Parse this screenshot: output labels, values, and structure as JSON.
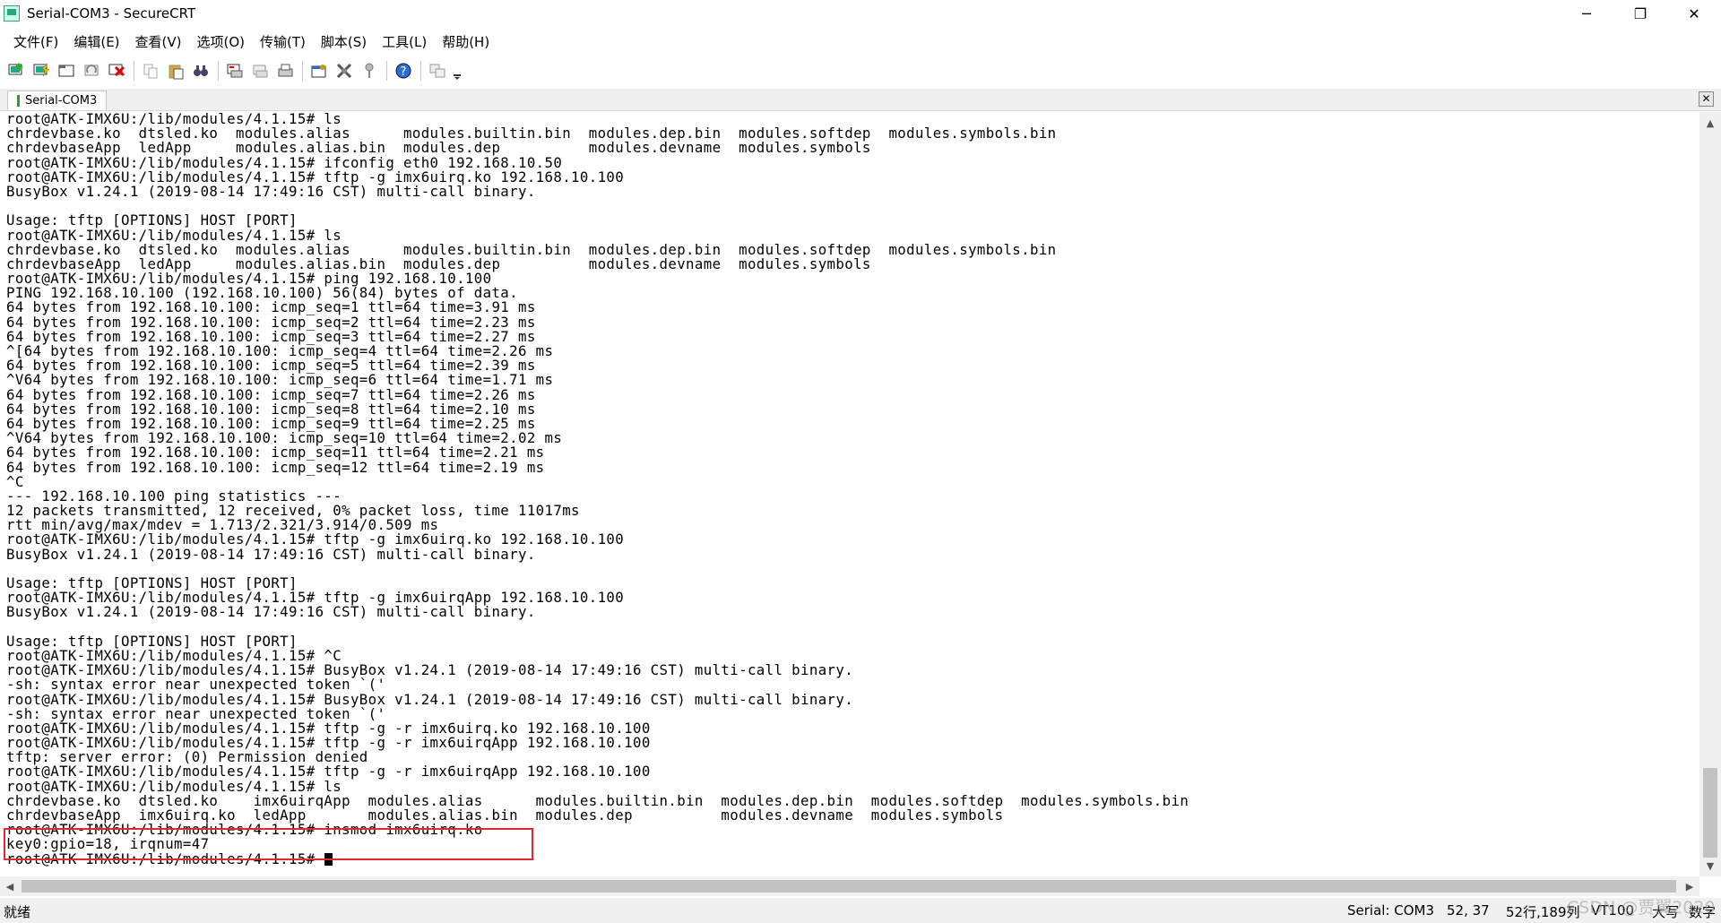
{
  "window": {
    "title": "Serial-COM3 - SecureCRT",
    "controls": [
      "─",
      "❐",
      "✕"
    ]
  },
  "menu": [
    "文件(F)",
    "编辑(E)",
    "查看(V)",
    "选项(O)",
    "传输(T)",
    "脚本(S)",
    "工具(L)",
    "帮助(H)"
  ],
  "toolbar": {
    "icons": [
      "connect-icon",
      "quick-connect-icon",
      "connect-in-tab-icon",
      "reconnect-icon",
      "disconnect-icon",
      "copy-icon",
      "paste-icon",
      "find-icon",
      "print-screen-icon",
      "print-selection-icon",
      "print-icon",
      "session-options-icon",
      "global-options-icon",
      "keymap-icon",
      "help-icon",
      "sftp-icon",
      "toolbar-overflow-icon"
    ]
  },
  "tab": {
    "label": "Serial-COM3",
    "close": "✕"
  },
  "terminal": {
    "lines": [
      "root@ATK-IMX6U:/lib/modules/4.1.15# ls",
      "chrdevbase.ko  dtsled.ko  modules.alias      modules.builtin.bin  modules.dep.bin  modules.softdep  modules.symbols.bin",
      "chrdevbaseApp  ledApp     modules.alias.bin  modules.dep          modules.devname  modules.symbols",
      "root@ATK-IMX6U:/lib/modules/4.1.15# ifconfig eth0 192.168.10.50",
      "root@ATK-IMX6U:/lib/modules/4.1.15# tftp -g imx6uirq.ko 192.168.10.100",
      "BusyBox v1.24.1 (2019-08-14 17:49:16 CST) multi-call binary.",
      "",
      "Usage: tftp [OPTIONS] HOST [PORT]",
      "root@ATK-IMX6U:/lib/modules/4.1.15# ls",
      "chrdevbase.ko  dtsled.ko  modules.alias      modules.builtin.bin  modules.dep.bin  modules.softdep  modules.symbols.bin",
      "chrdevbaseApp  ledApp     modules.alias.bin  modules.dep          modules.devname  modules.symbols",
      "root@ATK-IMX6U:/lib/modules/4.1.15# ping 192.168.10.100",
      "PING 192.168.10.100 (192.168.10.100) 56(84) bytes of data.",
      "64 bytes from 192.168.10.100: icmp_seq=1 ttl=64 time=3.91 ms",
      "64 bytes from 192.168.10.100: icmp_seq=2 ttl=64 time=2.23 ms",
      "64 bytes from 192.168.10.100: icmp_seq=3 ttl=64 time=2.27 ms",
      "^[64 bytes from 192.168.10.100: icmp_seq=4 ttl=64 time=2.26 ms",
      "64 bytes from 192.168.10.100: icmp_seq=5 ttl=64 time=2.39 ms",
      "^V64 bytes from 192.168.10.100: icmp_seq=6 ttl=64 time=1.71 ms",
      "64 bytes from 192.168.10.100: icmp_seq=7 ttl=64 time=2.26 ms",
      "64 bytes from 192.168.10.100: icmp_seq=8 ttl=64 time=2.10 ms",
      "64 bytes from 192.168.10.100: icmp_seq=9 ttl=64 time=2.25 ms",
      "^V64 bytes from 192.168.10.100: icmp_seq=10 ttl=64 time=2.02 ms",
      "64 bytes from 192.168.10.100: icmp_seq=11 ttl=64 time=2.21 ms",
      "64 bytes from 192.168.10.100: icmp_seq=12 ttl=64 time=2.19 ms",
      "^C",
      "--- 192.168.10.100 ping statistics ---",
      "12 packets transmitted, 12 received, 0% packet loss, time 11017ms",
      "rtt min/avg/max/mdev = 1.713/2.321/3.914/0.509 ms",
      "root@ATK-IMX6U:/lib/modules/4.1.15# tftp -g imx6uirq.ko 192.168.10.100",
      "BusyBox v1.24.1 (2019-08-14 17:49:16 CST) multi-call binary.",
      "",
      "Usage: tftp [OPTIONS] HOST [PORT]",
      "root@ATK-IMX6U:/lib/modules/4.1.15# tftp -g imx6uirqApp 192.168.10.100",
      "BusyBox v1.24.1 (2019-08-14 17:49:16 CST) multi-call binary.",
      "",
      "Usage: tftp [OPTIONS] HOST [PORT]",
      "root@ATK-IMX6U:/lib/modules/4.1.15# ^C",
      "root@ATK-IMX6U:/lib/modules/4.1.15# BusyBox v1.24.1 (2019-08-14 17:49:16 CST) multi-call binary.",
      "-sh: syntax error near unexpected token `('",
      "root@ATK-IMX6U:/lib/modules/4.1.15# BusyBox v1.24.1 (2019-08-14 17:49:16 CST) multi-call binary.",
      "-sh: syntax error near unexpected token `('",
      "root@ATK-IMX6U:/lib/modules/4.1.15# tftp -g -r imx6uirq.ko 192.168.10.100",
      "root@ATK-IMX6U:/lib/modules/4.1.15# tftp -g -r imx6uirqApp 192.168.10.100",
      "tftp: server error: (0) Permission denied",
      "root@ATK-IMX6U:/lib/modules/4.1.15# tftp -g -r imx6uirqApp 192.168.10.100",
      "root@ATK-IMX6U:/lib/modules/4.1.15# ls",
      "chrdevbase.ko  dtsled.ko    imx6uirqApp  modules.alias      modules.builtin.bin  modules.dep.bin  modules.softdep  modules.symbols.bin",
      "chrdevbaseApp  imx6uirq.ko  ledApp       modules.alias.bin  modules.dep          modules.devname  modules.symbols",
      "root@ATK-IMX6U:/lib/modules/4.1.15# insmod imx6uirq.ko",
      "key0:gpio=18, irqnum=47",
      "root@ATK-IMX6U:/lib/modules/4.1.15# "
    ]
  },
  "colors": {
    "highlight_box": "#e0282e",
    "tab_indicator": "#2aa02a"
  },
  "scrollbars": {
    "up": "▲",
    "down": "▼",
    "left": "◀",
    "right": "▶"
  },
  "status": {
    "ready": "就绪",
    "connection": "Serial: COM3",
    "cursor_pos": "52,  37",
    "size": "52行,189列",
    "terminal_type": "VT100",
    "caps": "大写",
    "num": "数字"
  },
  "watermark": "CSDN @贾翼2020"
}
